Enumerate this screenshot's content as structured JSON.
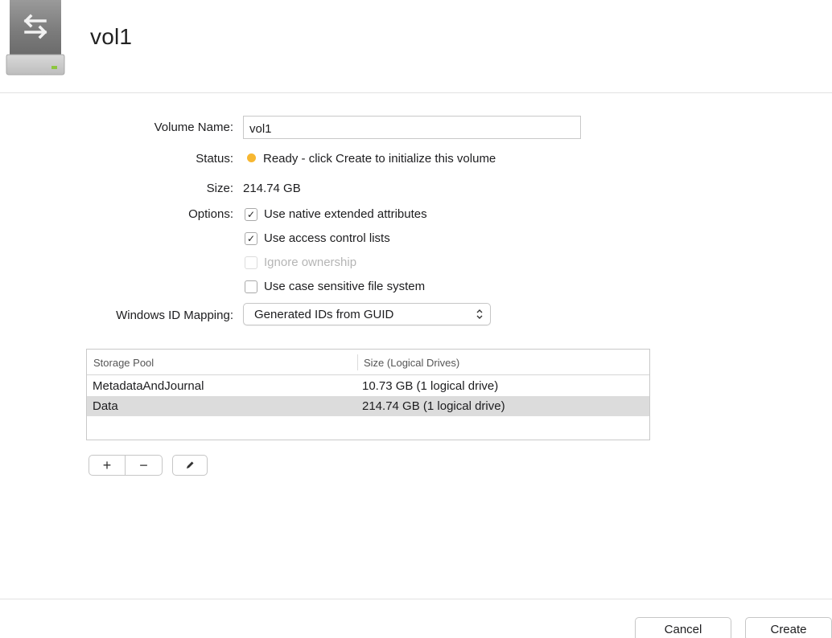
{
  "header": {
    "title": "vol1",
    "icon": "disk-drive-icon"
  },
  "form": {
    "volume_name_label": "Volume Name:",
    "volume_name_value": "vol1",
    "status_label": "Status:",
    "status_text": "Ready - click Create to initialize this volume",
    "status_color": "#f7b731",
    "size_label": "Size:",
    "size_value": "214.74 GB",
    "options_label": "Options:",
    "options": [
      {
        "label": "Use native extended attributes",
        "checked": true,
        "enabled": true
      },
      {
        "label": "Use access control lists",
        "checked": true,
        "enabled": true
      },
      {
        "label": "Ignore ownership",
        "checked": false,
        "enabled": false
      },
      {
        "label": "Use case sensitive file system",
        "checked": false,
        "enabled": true
      }
    ],
    "mapping_label": "Windows ID Mapping:",
    "mapping_value": "Generated IDs from GUID"
  },
  "table": {
    "headers": [
      "Storage Pool",
      "Size (Logical Drives)"
    ],
    "rows": [
      {
        "pool": "MetadataAndJournal",
        "size": "10.73 GB (1 logical drive)",
        "selected": false
      },
      {
        "pool": "Data",
        "size": "214.74 GB (1 logical drive)",
        "selected": true
      }
    ],
    "selected_color": "#dcdcdc"
  },
  "toolbar": {
    "add_label": "+",
    "remove_label": "−",
    "edit_icon": "pencil-icon"
  },
  "footer": {
    "cancel_label": "Cancel",
    "create_label": "Create"
  }
}
